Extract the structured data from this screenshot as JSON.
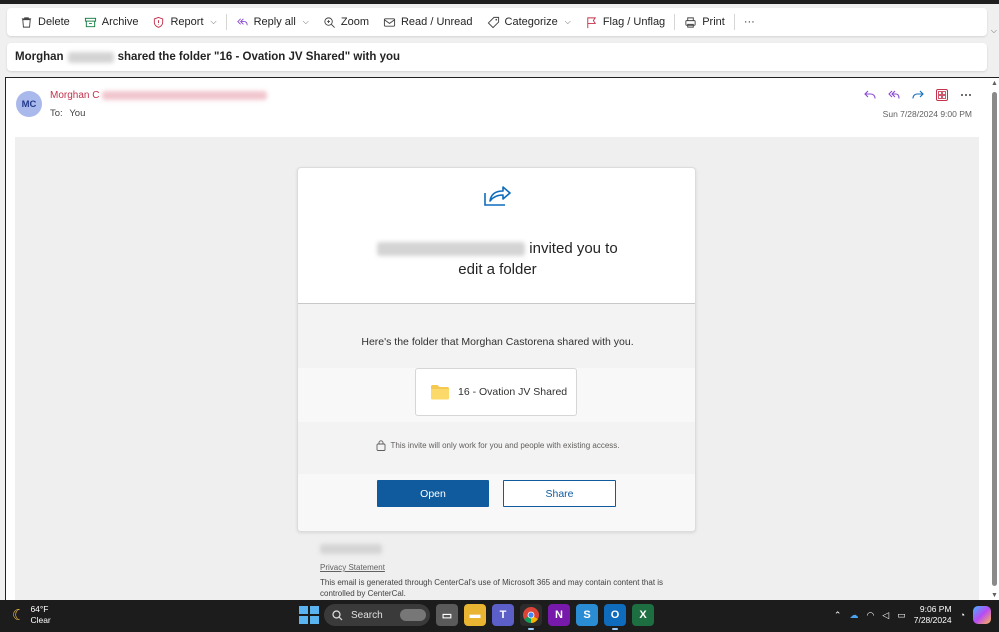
{
  "toolbar": {
    "delete": "Delete",
    "archive": "Archive",
    "report": "Report",
    "reply_all": "Reply all",
    "zoom": "Zoom",
    "read_unread": "Read / Unread",
    "categorize": "Categorize",
    "flag": "Flag / Unflag",
    "print": "Print",
    "more": "···"
  },
  "subject": {
    "name_visible": "Morghan",
    "rest": "shared the folder \"16 - Ovation JV Shared\" with you"
  },
  "message": {
    "avatar_initials": "MC",
    "sender_visible": "Morghan C",
    "to_label": "To:",
    "to_value": "You",
    "date": "Sun 7/28/2024 9:00 PM"
  },
  "card": {
    "headline_line1_suffix": "invited you to",
    "headline_line2": "edit a folder",
    "body_text": "Here's the folder that Morghan Castorena shared with you.",
    "folder_name": "16 - Ovation JV Shared",
    "invite_note": "This invite will only work for you and people with existing access.",
    "open_label": "Open",
    "share_label": "Share"
  },
  "footer": {
    "privacy": "Privacy Statement",
    "note": "This email is generated through CenterCal's use of Microsoft 365 and may contain content that is controlled by CenterCal."
  },
  "taskbar": {
    "temp": "64°F",
    "condition": "Clear",
    "search_label": "Search",
    "time": "9:06 PM",
    "date": "7/28/2024"
  },
  "colors": {
    "accent_blue": "#0f5b9e",
    "sender_red": "#c4314b",
    "action_purple": "#8a4bd1"
  }
}
